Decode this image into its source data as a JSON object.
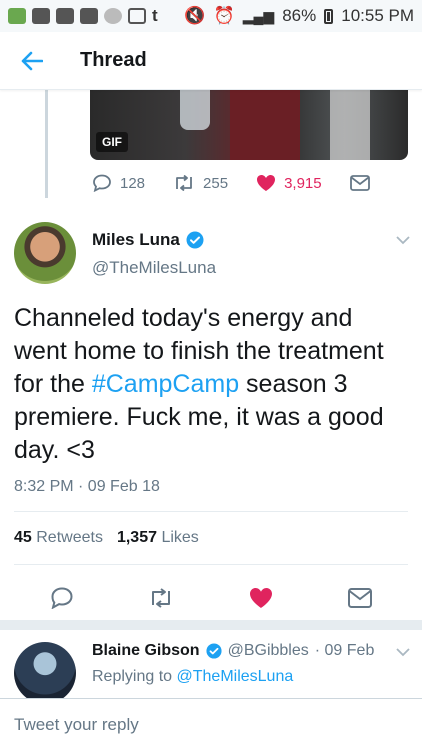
{
  "status_bar": {
    "battery": "86%",
    "time": "10:55 PM",
    "carrier_badge": "t"
  },
  "header": {
    "title": "Thread"
  },
  "previous_tweet": {
    "gif_badge": "GIF",
    "replies": "128",
    "retweets": "255",
    "likes": "3,915"
  },
  "tweet": {
    "author_name": "Miles Luna",
    "author_handle": "@TheMilesLuna",
    "text_line1": "Channeled today's energy and",
    "text_line2": "went home to finish the treatment",
    "text_line3_prefix": "for the ",
    "hashtag": "#CampCamp",
    "text_line3_suffix": " season 3",
    "text_line4": "premiere. Fuck me, it was a good",
    "text_line5": "day. <3",
    "timestamp": "8:32 PM · 09 Feb 18",
    "retweet_count": "45",
    "retweet_label": "Retweets",
    "like_count": "1,357",
    "like_label": "Likes"
  },
  "reply": {
    "author_name": "Blaine Gibson",
    "author_handle": "@BGibbles",
    "date": "· 09 Feb",
    "replying_to_label": "Replying to",
    "replying_to_handle": "@TheMilesLuna"
  },
  "composer": {
    "placeholder": "Tweet your reply"
  },
  "colors": {
    "accent": "#1da1f2",
    "like": "#e0245e",
    "muted": "#657786"
  }
}
